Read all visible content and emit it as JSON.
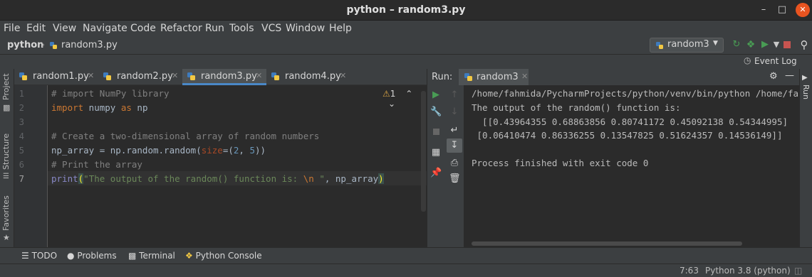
{
  "window": {
    "title": "python – random3.py"
  },
  "menu": [
    "File",
    "Edit",
    "View",
    "Navigate",
    "Code",
    "Refactor",
    "Run",
    "Tools",
    "VCS",
    "Window",
    "Help"
  ],
  "breadcrumb": {
    "project": "python",
    "file": "random3.py"
  },
  "toolbar": {
    "run_config": "random3",
    "event_log": "Event Log"
  },
  "left_stripe": {
    "project": "Project",
    "structure": "Structure",
    "favorites": "Favorites"
  },
  "editor_tabs": [
    {
      "label": "random1.py"
    },
    {
      "label": "random2.py"
    },
    {
      "label": "random3.py"
    },
    {
      "label": "random4.py"
    }
  ],
  "editor": {
    "line_numbers": [
      "1",
      "2",
      "3",
      "4",
      "5",
      "6",
      "7"
    ],
    "warning_count": "1",
    "line1": "# import NumPy library",
    "line2_kw1": "import",
    "line2_mid": " numpy ",
    "line2_kw2": "as",
    "line2_end": " np",
    "line4": "# Create a two-dimensional array of random numbers",
    "line5_a": "np_array = np.random.random(",
    "line5_param": "size",
    "line5_b": "=(",
    "line5_n1": "2",
    "line5_c": ", ",
    "line5_n2": "5",
    "line5_d": "))",
    "line6": "# Print the array",
    "line7_fn": "print",
    "line7_p1": "(",
    "line7_str1": "\"The output of the random() function is: ",
    "line7_esc": "\\n",
    "line7_str2": " \"",
    "line7_rest": ", np_array",
    "line7_p2": ")"
  },
  "run": {
    "label": "Run:",
    "tab": "random3",
    "right_label": "Run",
    "lines": [
      "/home/fahmida/PycharmProjects/python/venv/bin/python /home/fahmida",
      "The output of the random() function is:",
      "  [[0.43964355 0.68863856 0.80741172 0.45092138 0.54344995]",
      " [0.06410474 0.86336255 0.13547825 0.51624357 0.14536149]]",
      "",
      "Process finished with exit code 0"
    ]
  },
  "bottom_tools": [
    {
      "label": "TODO"
    },
    {
      "label": "Problems"
    },
    {
      "label": "Terminal"
    },
    {
      "label": "Python Console"
    }
  ],
  "status": {
    "position": "7:63",
    "interpreter": "Python 3.8 (python)"
  },
  "colors": {
    "accent": "#4a88c7",
    "run_green": "#499c54",
    "stop_red": "#c75450",
    "close_orange": "#e95420"
  }
}
